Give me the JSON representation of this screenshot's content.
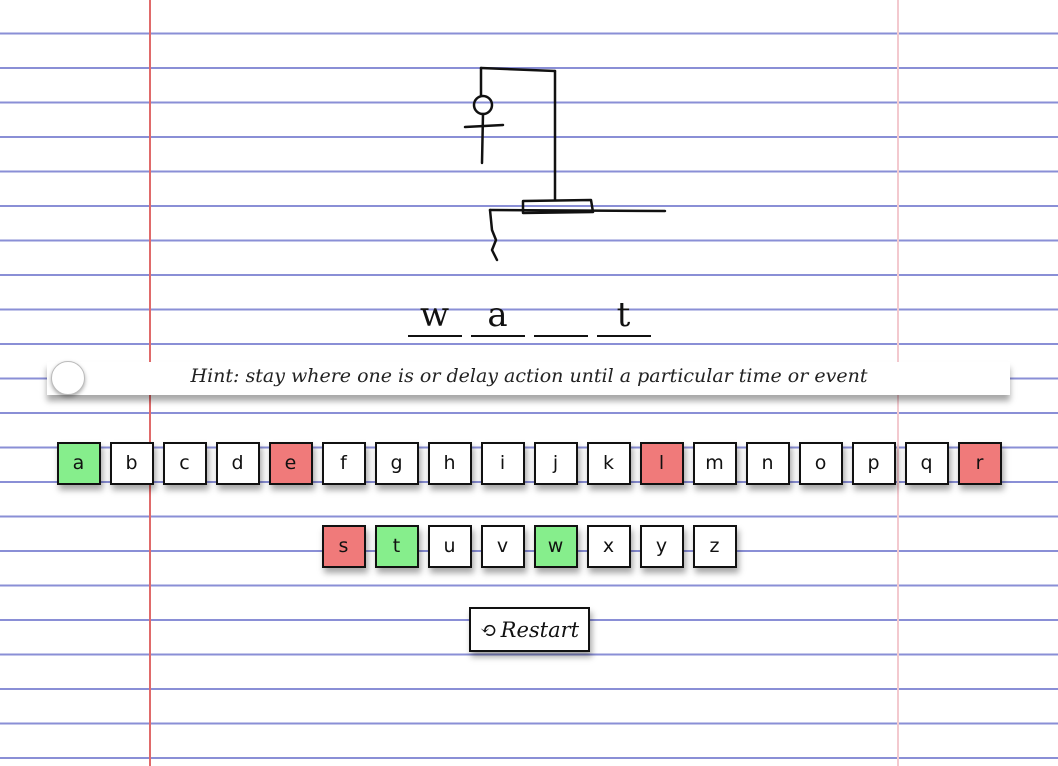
{
  "word": {
    "letters": [
      "w",
      "a",
      "",
      "t"
    ]
  },
  "hint": {
    "text": "Hint: stay where one is or delay action until a particular time or event"
  },
  "keyboard": {
    "row1": [
      {
        "label": "a",
        "state": "correct"
      },
      {
        "label": "b",
        "state": "unused"
      },
      {
        "label": "c",
        "state": "unused"
      },
      {
        "label": "d",
        "state": "unused"
      },
      {
        "label": "e",
        "state": "wrong"
      },
      {
        "label": "f",
        "state": "unused"
      },
      {
        "label": "g",
        "state": "unused"
      },
      {
        "label": "h",
        "state": "unused"
      },
      {
        "label": "i",
        "state": "unused"
      },
      {
        "label": "j",
        "state": "unused"
      },
      {
        "label": "k",
        "state": "unused"
      },
      {
        "label": "l",
        "state": "wrong"
      },
      {
        "label": "m",
        "state": "unused"
      },
      {
        "label": "n",
        "state": "unused"
      },
      {
        "label": "o",
        "state": "unused"
      },
      {
        "label": "p",
        "state": "unused"
      },
      {
        "label": "q",
        "state": "unused"
      },
      {
        "label": "r",
        "state": "wrong"
      }
    ],
    "row2": [
      {
        "label": "s",
        "state": "wrong"
      },
      {
        "label": "t",
        "state": "correct"
      },
      {
        "label": "u",
        "state": "unused"
      },
      {
        "label": "v",
        "state": "unused"
      },
      {
        "label": "w",
        "state": "correct"
      },
      {
        "label": "x",
        "state": "unused"
      },
      {
        "label": "y",
        "state": "unused"
      },
      {
        "label": "z",
        "state": "unused"
      }
    ]
  },
  "restart": {
    "label": "Restart",
    "icon": "restart-icon"
  },
  "colors": {
    "correct": "#86ee8c",
    "wrong": "#f07a7a",
    "notebook_line": "#8a8fd6",
    "margin_line": "#e06a6a"
  }
}
